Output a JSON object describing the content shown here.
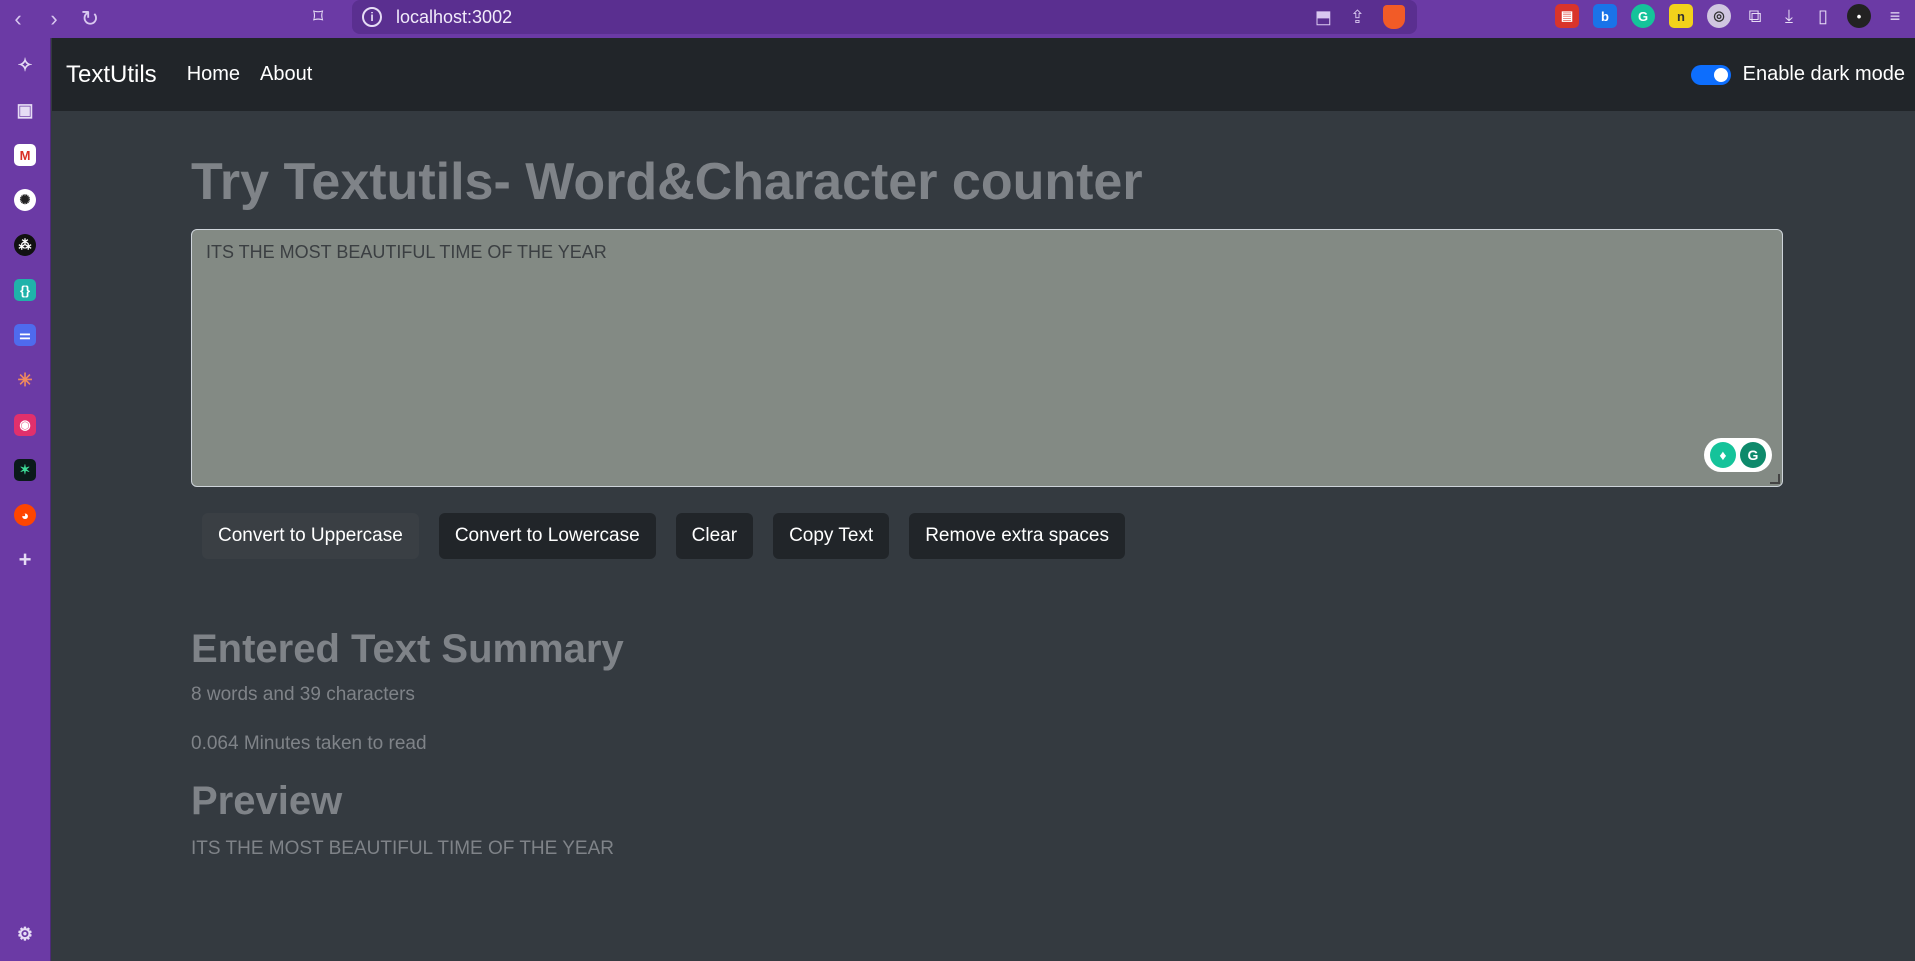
{
  "browser": {
    "url": "localhost:3002"
  },
  "navbar": {
    "brand": "TextUtils",
    "links": [
      "Home",
      "About"
    ],
    "dark_mode_label": "Enable dark mode",
    "dark_mode_enabled": true
  },
  "main": {
    "heading": "Try Textutils- Word&Character counter",
    "textarea_value": "ITS THE MOST BEAUTIFUL TIME OF THE YEAR",
    "buttons": [
      "Convert to Uppercase",
      "Convert to Lowercase",
      "Clear",
      "Copy Text",
      "Remove extra spaces"
    ],
    "summary_title": "Entered Text Summary",
    "word_char_count": "8 words and 39 characters",
    "read_time": "0.064 Minutes taken to read",
    "preview_title": "Preview",
    "preview_text": "ITS THE MOST BEAUTIFUL TIME OF THE YEAR"
  },
  "colors": {
    "browser_chrome": "#6b3aa5",
    "navbar_bg": "#212529",
    "page_bg": "#343a40",
    "accent": "#0d6efd"
  }
}
